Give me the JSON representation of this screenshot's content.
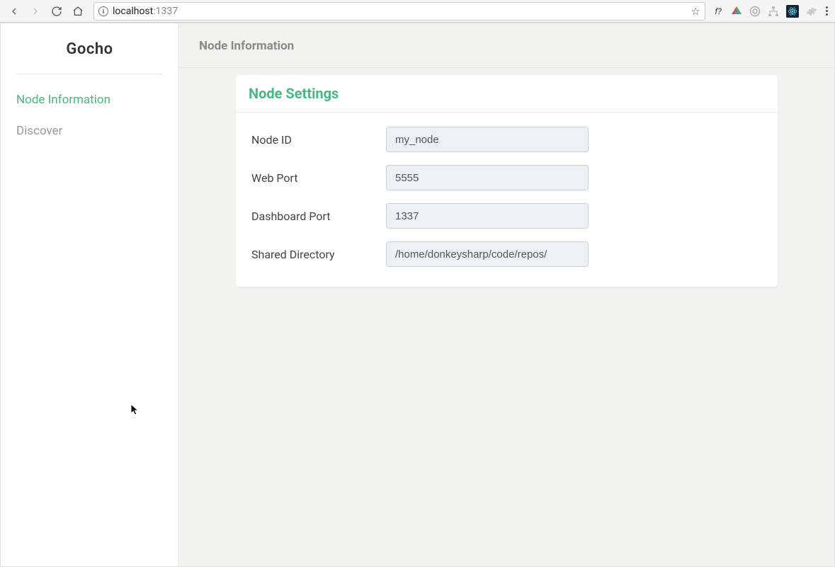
{
  "browser": {
    "url_host": "localhost",
    "url_port": ":1337",
    "ext_fq": "f?"
  },
  "sidebar": {
    "brand": "Gocho",
    "items": [
      {
        "label": "Node Information",
        "active": true
      },
      {
        "label": "Discover",
        "active": false
      }
    ]
  },
  "header": {
    "title": "Node Information"
  },
  "card": {
    "title": "Node Settings",
    "fields": [
      {
        "label": "Node ID",
        "value": "my_node"
      },
      {
        "label": "Web Port",
        "value": "5555"
      },
      {
        "label": "Dashboard Port",
        "value": "1337"
      },
      {
        "label": "Shared Directory",
        "value": "/home/donkeysharp/code/repos/"
      }
    ]
  }
}
